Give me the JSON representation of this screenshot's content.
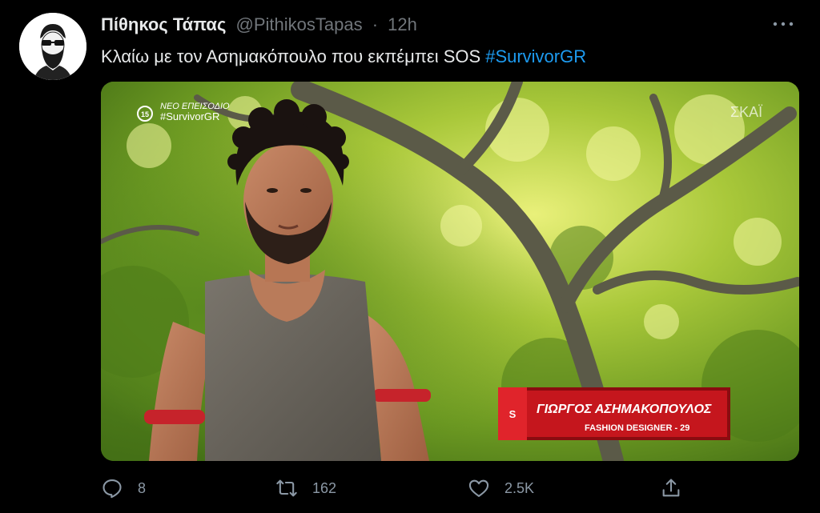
{
  "tweet": {
    "display_name": "Πίθηκος Τάπας",
    "handle": "@PithikosTapas",
    "separator": "·",
    "time": "12h",
    "text": "Κλαίω με τον Ασημακόπουλο που εκπέμπει SOS",
    "hashtag": "#SurvivorGR"
  },
  "media": {
    "overlay_top_left_line1": "ΝΕΟ ΕΠΕΙΣΟΔΙΟ",
    "overlay_top_left_line2": "#SurvivorGR",
    "channel_logo": "ΣΚΑΪ",
    "lower_third_name": "ΓΙΩΡΓΟΣ ΑΣΗΜΑΚΟΠΟΥΛΟΣ",
    "lower_third_subtitle": "FASHION DESIGNER - 29",
    "rating_badge": "15"
  },
  "actions": {
    "replies": "8",
    "retweets": "162",
    "likes": "2.5K"
  },
  "icons": {
    "more": "more-icon",
    "reply": "reply-icon",
    "retweet": "retweet-icon",
    "like": "heart-icon",
    "share": "share-icon"
  },
  "colors": {
    "background": "#000000",
    "hashtag": "#1d9bf0",
    "muted": "#71767b",
    "lower_third_red": "#c5161d"
  }
}
